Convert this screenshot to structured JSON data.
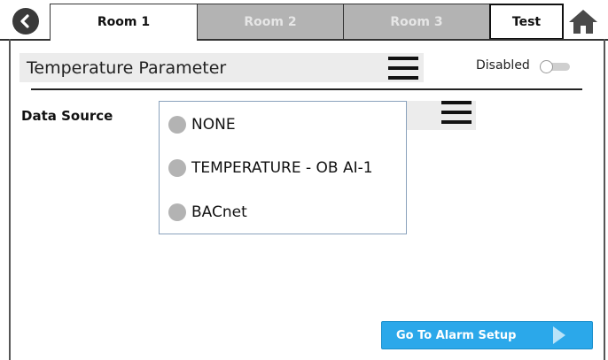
{
  "tabs": [
    {
      "label": "Room 1",
      "active": true
    },
    {
      "label": "Room 2",
      "active": false
    },
    {
      "label": "Room 3",
      "active": false
    },
    {
      "label": "Test",
      "active": true
    }
  ],
  "icons": {
    "back": "chevron-left-circle-icon",
    "home": "home-icon",
    "menu": "hamburger-menu-icon",
    "arrow": "play-arrow-icon"
  },
  "parameter": {
    "title": "Temperature Parameter",
    "status_label": "Disabled",
    "enabled": false
  },
  "data_source": {
    "label": "Data Source",
    "options": [
      "NONE",
      "TEMPERATURE - OB AI-1",
      "BACnet"
    ]
  },
  "actions": {
    "alarm_setup_label": "Go To Alarm Setup"
  },
  "colors": {
    "accent": "#2ba8ea",
    "inactive_tab": "#b3b3b3",
    "panel": "#ececec"
  }
}
